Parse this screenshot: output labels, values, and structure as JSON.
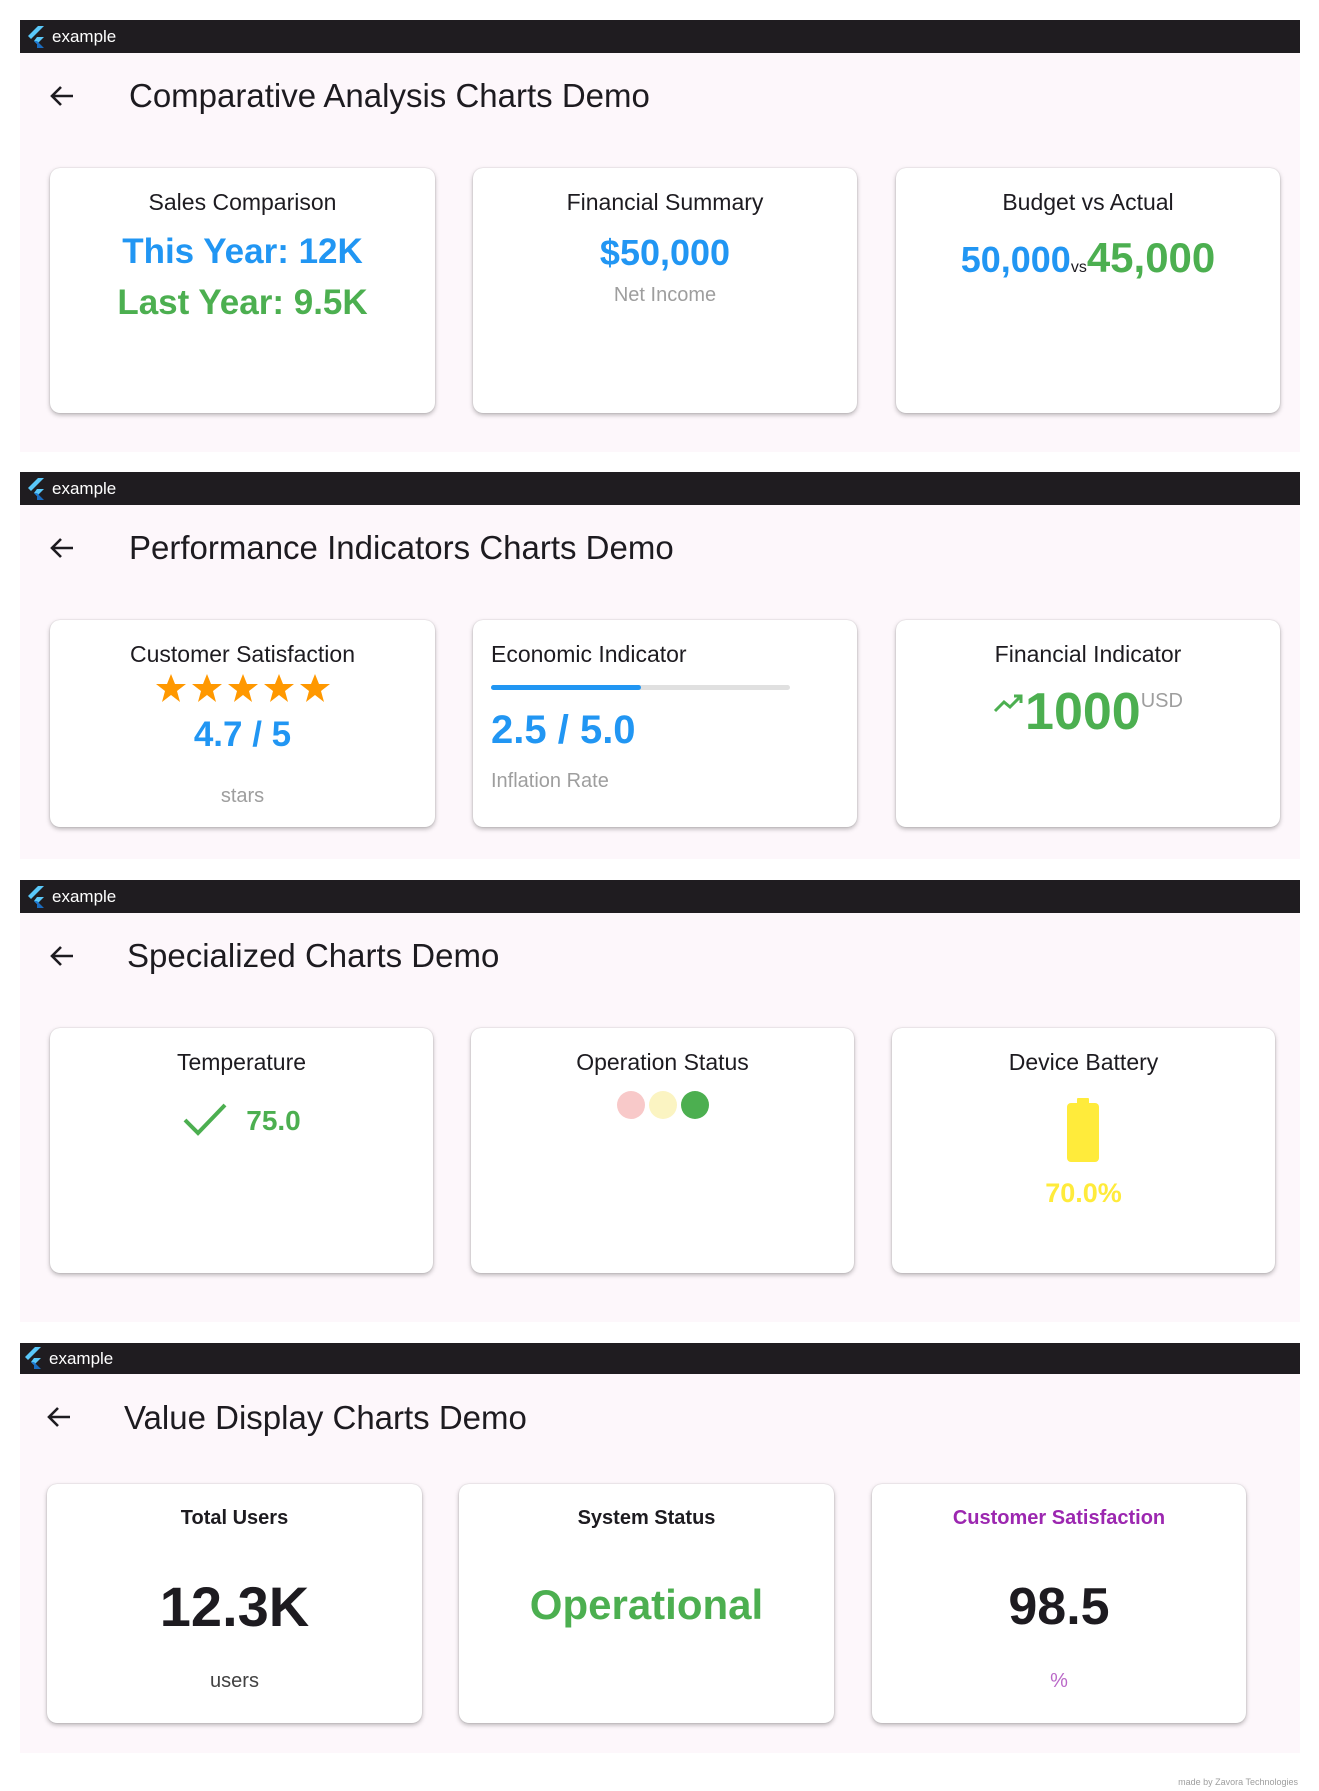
{
  "windows": [
    {
      "app_title": "example",
      "page_title": "Comparative Analysis Charts Demo",
      "cards": {
        "sales": {
          "title": "Sales Comparison",
          "this_year": "This Year: 12K",
          "last_year": "Last Year: 9.5K"
        },
        "financial": {
          "title": "Financial Summary",
          "value": "$50,000",
          "label": "Net Income"
        },
        "budget": {
          "title": "Budget vs Actual",
          "budget": "50,000",
          "vs": "vs",
          "actual": "45,000"
        }
      }
    },
    {
      "app_title": "example",
      "page_title": "Performance Indicators Charts Demo",
      "cards": {
        "satisfaction": {
          "title": "Customer Satisfaction",
          "rating": 4.7,
          "max": 5,
          "value": "4.7 / 5",
          "unit": "stars"
        },
        "economic": {
          "title": "Economic Indicator",
          "progress": 0.5,
          "value": "2.5 / 5.0",
          "label": "Inflation Rate"
        },
        "financial_indicator": {
          "title": "Financial Indicator",
          "value": "1000",
          "unit": "USD",
          "trend_icon": "trending-up-icon"
        }
      }
    },
    {
      "app_title": "example",
      "page_title": "Specialized Charts Demo",
      "cards": {
        "temperature": {
          "title": "Temperature",
          "value": "75.0",
          "status_icon": "check-icon"
        },
        "operation": {
          "title": "Operation Status",
          "lights": [
            "#f8c9c9",
            "#fbf4c2",
            "#4caf50"
          ]
        },
        "battery": {
          "title": "Device Battery",
          "level": 0.7,
          "value": "70.0%",
          "color": "#ffeb3b"
        }
      }
    },
    {
      "app_title": "example",
      "page_title": "Value Display Charts Demo",
      "cards": {
        "users": {
          "title": "Total Users",
          "value": "12.3K",
          "unit": "users"
        },
        "system": {
          "title": "System Status",
          "value": "Operational"
        },
        "csat": {
          "title": "Customer Satisfaction",
          "value": "98.5",
          "unit": "%"
        }
      }
    }
  ],
  "footer": "made by Zavora Technologies",
  "colors": {
    "blue": "#2196f3",
    "green": "#4caf50",
    "purple": "#9c27b0",
    "star": "#ff9800",
    "battery": "#ffeb3b",
    "titlebar": "#1f1c20",
    "background": "#fdf7fb"
  }
}
